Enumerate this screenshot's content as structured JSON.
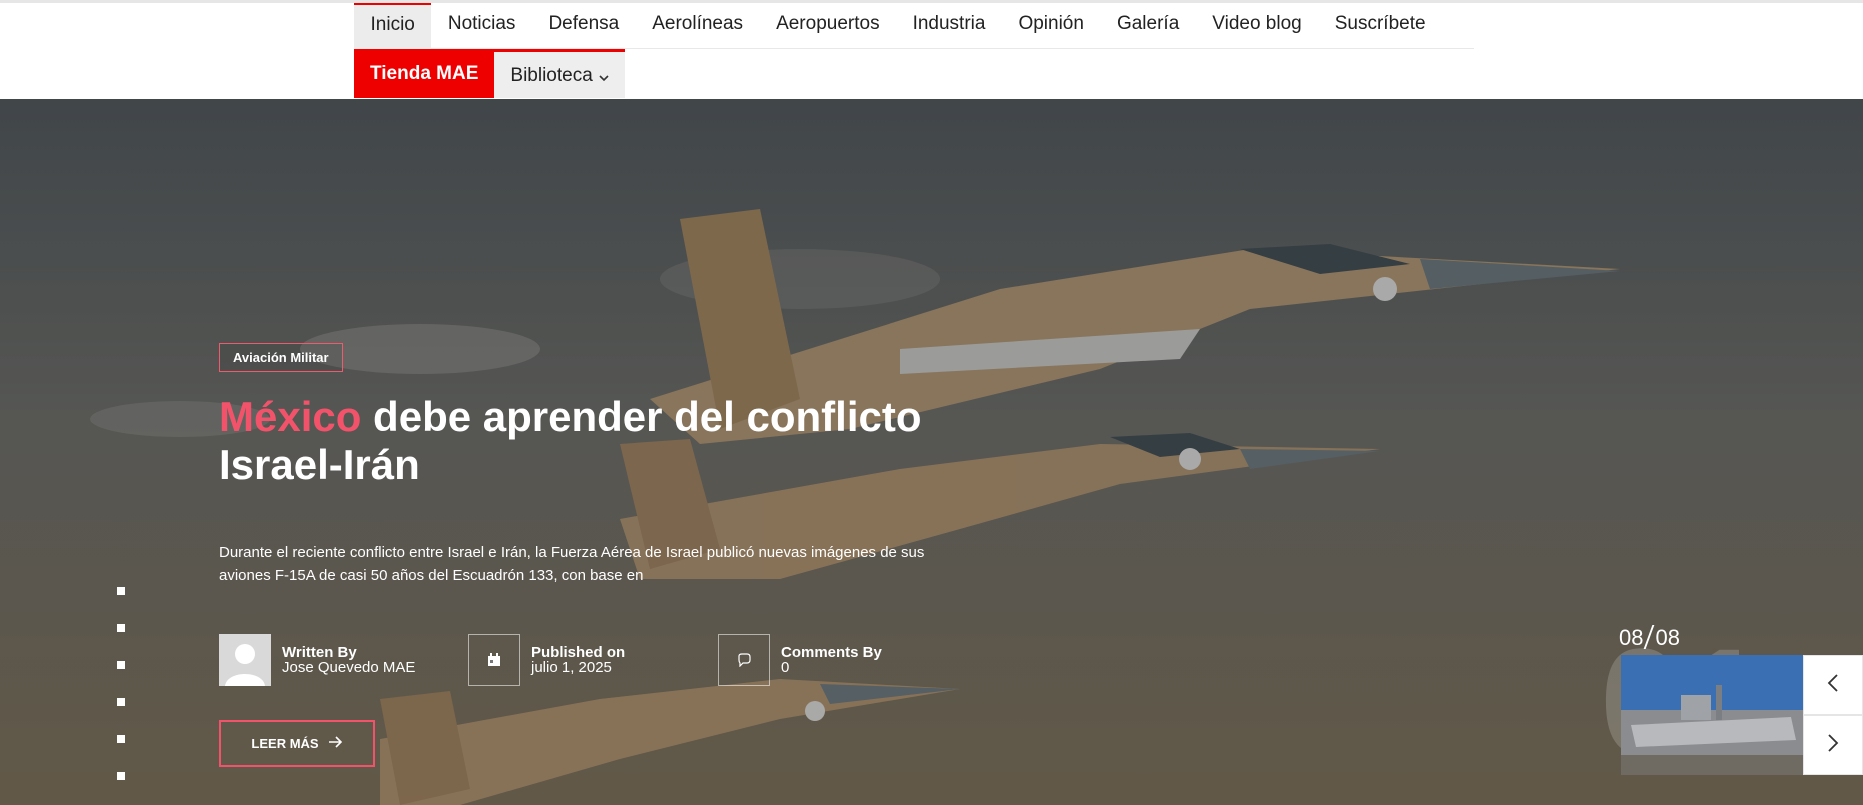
{
  "nav": {
    "row1": [
      "Inicio",
      "Noticias",
      "Defensa",
      "Aerolíneas",
      "Aeropuertos",
      "Industria",
      "Opinión",
      "Galería",
      "Video blog",
      "Suscríbete"
    ],
    "tienda": "Tienda MAE",
    "biblioteca": "Biblioteca"
  },
  "hero": {
    "category": "Aviación Militar",
    "title_highlight": "México",
    "title_rest": " debe aprender del conflicto Israel-Irán",
    "excerpt": "Durante el reciente conflicto entre Israel e Irán, la Fuerza Aérea de Israel publicó nuevas imágenes de sus aviones F-15A de casi 50 años del Escuadrón 133, con base en",
    "author_label": "Written By",
    "author": "Jose Quevedo MAE",
    "published_label": "Published on",
    "published": "julio 1, 2025",
    "comments_label": "Comments By",
    "comments": "0",
    "read_more": "LEER MÁS",
    "counter_current": "08",
    "counter_total": "08",
    "big_number": "01",
    "slide_dots": 6
  },
  "colors": {
    "accent_red": "#ee0000",
    "highlight_pink": "#f2536a"
  }
}
